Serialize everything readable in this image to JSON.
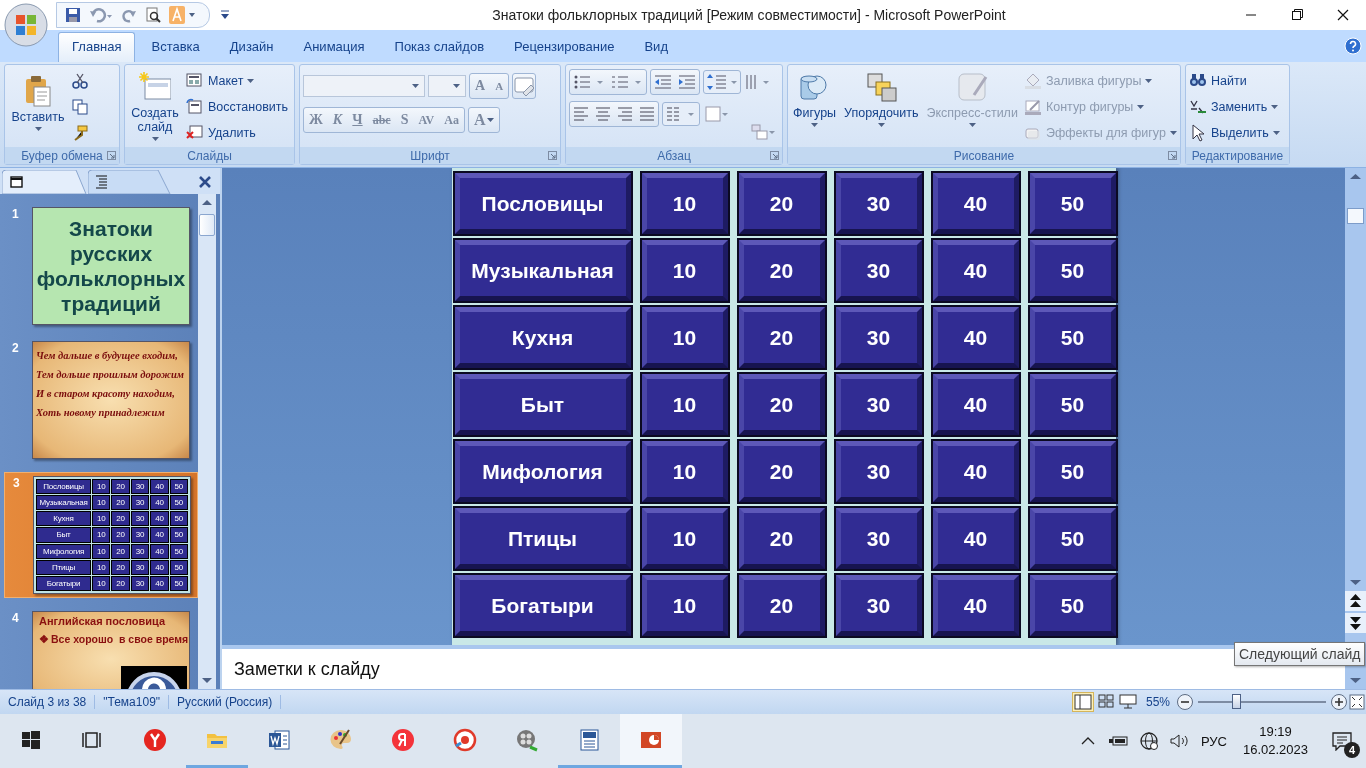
{
  "window": {
    "title": "Знатоки фольклорных традиций [Режим совместимости] - Microsoft PowerPoint"
  },
  "ribbon_tabs": [
    {
      "label": "Главная",
      "selected": true
    },
    {
      "label": "Вставка",
      "selected": false
    },
    {
      "label": "Дизайн",
      "selected": false
    },
    {
      "label": "Анимация",
      "selected": false
    },
    {
      "label": "Показ слайдов",
      "selected": false
    },
    {
      "label": "Рецензирование",
      "selected": false
    },
    {
      "label": "Вид",
      "selected": false
    }
  ],
  "ribbon_groups": [
    {
      "title": "Буфер обмена",
      "kind": "clipboard",
      "items": [
        {
          "kind": "paste",
          "label": "Вставить"
        }
      ]
    },
    {
      "title": "Слайды",
      "kind": "slides",
      "items": [
        {
          "kind": "new-slide",
          "label": "Создать слайд"
        },
        {
          "kind": "layout",
          "label": "Макет"
        },
        {
          "kind": "reset",
          "label": "Восстановить"
        },
        {
          "kind": "delete",
          "label": "Удалить"
        }
      ]
    },
    {
      "title": "Шрифт",
      "kind": "font",
      "size_buttons": [
        "A",
        "A"
      ],
      "format_buttons": [
        "Ж",
        "К",
        "Ч",
        "abc",
        "S",
        "AV",
        "Aa"
      ],
      "color_button": "A"
    },
    {
      "title": "Абзац",
      "kind": "paragraph"
    },
    {
      "title": "Рисование",
      "kind": "drawing",
      "items": [
        {
          "kind": "shapes",
          "label": "Фигуры",
          "disabled": false
        },
        {
          "kind": "arrange",
          "label": "Упорядочить",
          "disabled": false
        },
        {
          "kind": "styles",
          "label": "Экспресс-стили",
          "disabled": true
        },
        {
          "kind": "fill",
          "label": "Заливка фигуры",
          "disabled": true
        },
        {
          "kind": "outline",
          "label": "Контур фигуры",
          "disabled": true
        },
        {
          "kind": "effects",
          "label": "Эффекты для фигур",
          "disabled": true
        }
      ]
    },
    {
      "title": "Редактирование",
      "kind": "editing",
      "items": [
        {
          "kind": "find",
          "label": "Найти"
        },
        {
          "kind": "replace",
          "label": "Заменить"
        },
        {
          "kind": "select",
          "label": "Выделить"
        }
      ]
    }
  ],
  "slide_panel": {
    "thumbnails": [
      {
        "number": "1",
        "kind": "title",
        "text": "Знатоки русских фольклорных традиций",
        "selected": false
      },
      {
        "number": "2",
        "kind": "poem",
        "lines": [
          "Чем дальше в будущее входим,",
          "Тем дольше прошлым дорожим",
          "И в старом красоту находим,",
          "Хоть новому принадлежим"
        ],
        "selected": false
      },
      {
        "number": "3",
        "kind": "board",
        "rows": [
          {
            "category": "Пословицы",
            "values": [
              "10",
              "20",
              "30",
              "40",
              "50"
            ]
          },
          {
            "category": "Музыкальная",
            "values": [
              "10",
              "20",
              "30",
              "40",
              "50"
            ]
          },
          {
            "category": "Кухня",
            "values": [
              "10",
              "20",
              "30",
              "40",
              "50"
            ]
          },
          {
            "category": "Быт",
            "values": [
              "10",
              "20",
              "30",
              "40",
              "50"
            ]
          },
          {
            "category": "Мифология",
            "values": [
              "10",
              "20",
              "30",
              "40",
              "50"
            ]
          },
          {
            "category": "Птицы",
            "values": [
              "10",
              "20",
              "30",
              "40",
              "50"
            ]
          },
          {
            "category": "Богатыри",
            "values": [
              "10",
              "20",
              "30",
              "40",
              "50"
            ]
          }
        ],
        "selected": true
      },
      {
        "number": "4",
        "kind": "proverb",
        "heading": "Английская пословица",
        "bullet": "❖",
        "text": "Все хорошо  в свое время",
        "selected": false
      }
    ]
  },
  "slide": {
    "board": [
      {
        "category": "Пословицы",
        "values": [
          "10",
          "20",
          "30",
          "40",
          "50"
        ]
      },
      {
        "category": "Музыкальная",
        "values": [
          "10",
          "20",
          "30",
          "40",
          "50"
        ]
      },
      {
        "category": "Кухня",
        "values": [
          "10",
          "20",
          "30",
          "40",
          "50"
        ]
      },
      {
        "category": "Быт",
        "values": [
          "10",
          "20",
          "30",
          "40",
          "50"
        ]
      },
      {
        "category": "Мифология",
        "values": [
          "10",
          "20",
          "30",
          "40",
          "50"
        ]
      },
      {
        "category": "Птицы",
        "values": [
          "10",
          "20",
          "30",
          "40",
          "50"
        ]
      },
      {
        "category": "Богатыри",
        "values": [
          "10",
          "20",
          "30",
          "40",
          "50"
        ]
      }
    ]
  },
  "notes": {
    "placeholder": "Заметки к слайду"
  },
  "tooltip": "Следующий слайд",
  "status_bar": {
    "slide": "Слайд 3 из 38",
    "theme": "\"Тема109\"",
    "language": "Русский (Россия)",
    "zoom": "55%",
    "zoom_slider": {
      "level": 0.3
    }
  },
  "taskbar": {
    "items": [
      {
        "kind": "start",
        "selected": false,
        "running": false
      },
      {
        "kind": "task-view",
        "selected": false,
        "running": false
      },
      {
        "kind": "browser",
        "selected": false,
        "running": false
      },
      {
        "kind": "folder",
        "selected": false,
        "running": true
      },
      {
        "kind": "word",
        "selected": false,
        "running": false
      },
      {
        "kind": "paint",
        "selected": false,
        "running": false
      },
      {
        "kind": "ya",
        "selected": false,
        "running": false
      },
      {
        "kind": "disc",
        "selected": false,
        "running": false
      },
      {
        "kind": "film",
        "selected": false,
        "running": false
      },
      {
        "kind": "document",
        "selected": false,
        "running": true
      },
      {
        "kind": "powerpoint",
        "selected": true,
        "running": true
      }
    ],
    "tray": {
      "language": "РУС",
      "time": "19:19",
      "date": "16.02.2023",
      "notifications": "4"
    }
  }
}
